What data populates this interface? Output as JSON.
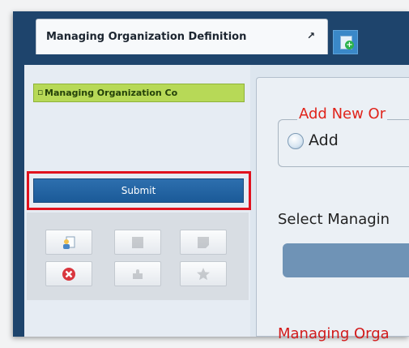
{
  "tabs": {
    "active_label": "Managing Organization Definition",
    "close_glyph": "↗",
    "new_tab_icon": "new-document-icon"
  },
  "left_panel": {
    "tree_item": "Managing Organization Co"
  },
  "submit": {
    "label": "Submit"
  },
  "toolbar": {
    "buttons": [
      {
        "icon": "user-document-icon",
        "enabled": true
      },
      {
        "icon": "grid-icon",
        "enabled": false
      },
      {
        "icon": "note-icon",
        "enabled": false
      },
      {
        "icon": "cancel-icon",
        "enabled": true
      },
      {
        "icon": "puzzle-icon",
        "enabled": false
      },
      {
        "icon": "star-icon",
        "enabled": false
      }
    ]
  },
  "main": {
    "group_legend": "Add New Or",
    "radio_label": "Add",
    "select_label": "Select Managin",
    "bottom_label": "Managing Orga"
  },
  "colors": {
    "app_frame": "#1e446c",
    "tree_item_bg": "#b7d957",
    "submit_bg": "#1b5a98",
    "highlight": "#e0121e",
    "legend_text": "#e0241b"
  }
}
